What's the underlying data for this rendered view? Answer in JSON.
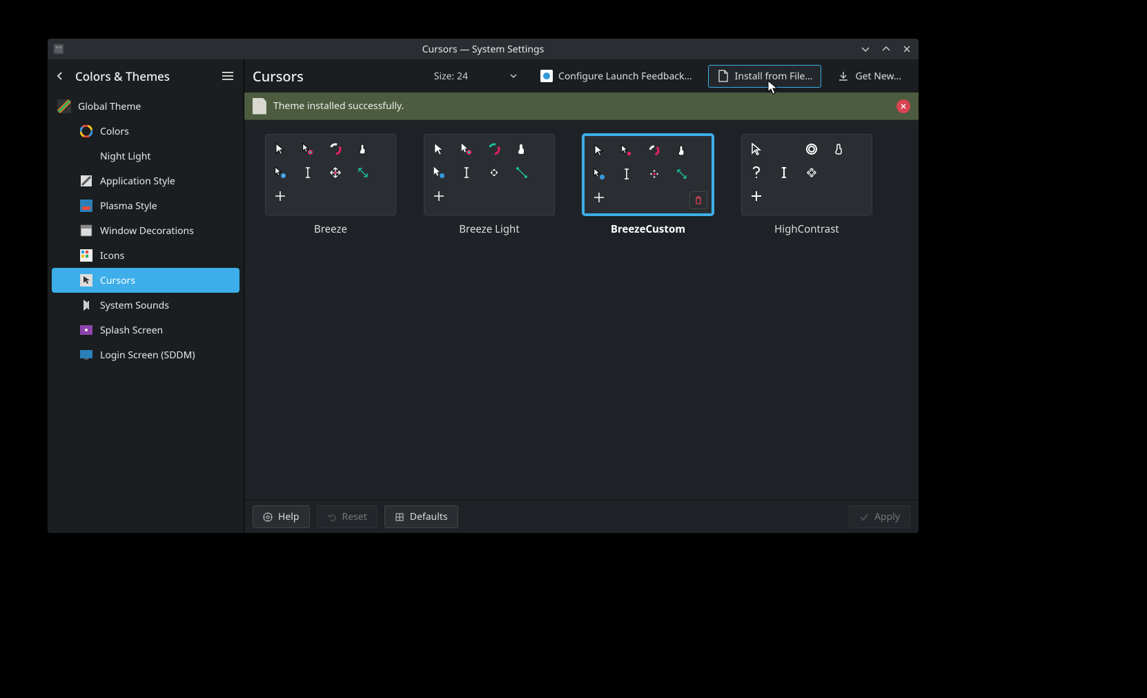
{
  "window": {
    "title": "Cursors — System Settings"
  },
  "sidebar": {
    "category": "Colors & Themes",
    "top_item": {
      "label": "Global Theme"
    },
    "items": [
      {
        "label": "Colors"
      },
      {
        "label": "Night Light"
      },
      {
        "label": "Application Style"
      },
      {
        "label": "Plasma Style"
      },
      {
        "label": "Window Decorations"
      },
      {
        "label": "Icons"
      },
      {
        "label": "Cursors"
      },
      {
        "label": "System Sounds"
      },
      {
        "label": "Splash Screen"
      },
      {
        "label": "Login Screen (SDDM)"
      }
    ],
    "selected_index": 6
  },
  "main": {
    "title": "Cursors",
    "size_label": "Size:",
    "size_value": "24",
    "buttons": {
      "launch_feedback": "Configure Launch Feedback…",
      "install_file": "Install from File…",
      "get_new": "Get New…"
    }
  },
  "notification": {
    "message": "Theme installed successfully."
  },
  "themes": [
    {
      "name": "Breeze",
      "selected": false,
      "deletable": false,
      "style": "dark"
    },
    {
      "name": "Breeze Light",
      "selected": false,
      "deletable": false,
      "style": "light"
    },
    {
      "name": "BreezeCustom",
      "selected": true,
      "deletable": true,
      "style": "dark"
    },
    {
      "name": "HighContrast",
      "selected": false,
      "deletable": false,
      "style": "mono"
    }
  ],
  "footer": {
    "help": "Help",
    "reset": "Reset",
    "defaults": "Defaults",
    "apply": "Apply"
  }
}
